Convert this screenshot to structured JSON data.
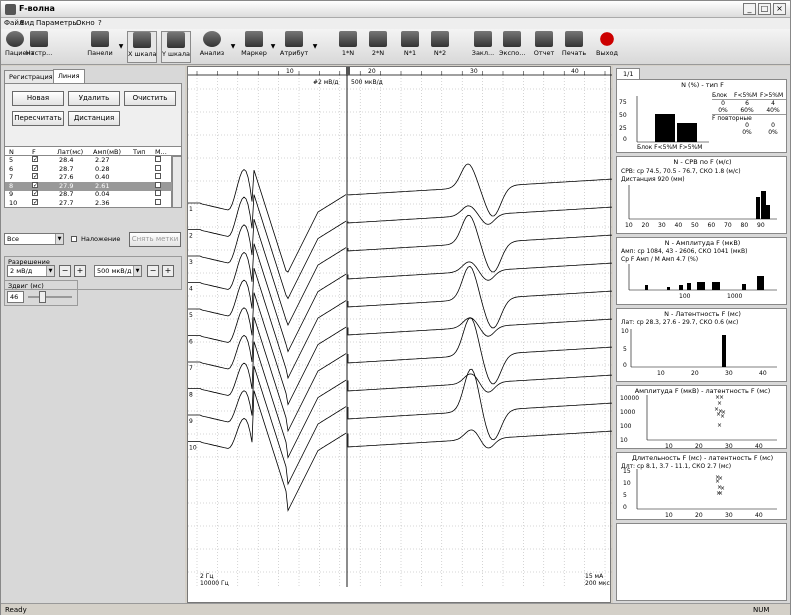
{
  "window": {
    "title": "F-волна",
    "status_left": "Ready",
    "status_right": "NUM"
  },
  "menu": [
    "Файл",
    "Вид",
    "Параметры",
    "Окно",
    "?"
  ],
  "toolbar": [
    {
      "label": "Пациент",
      "icon": "patient-icon"
    },
    {
      "label": "Настр...",
      "icon": "settings-icon"
    },
    {
      "label": "Панели",
      "icon": "panels-icon"
    },
    {
      "label": "X шкала",
      "icon": "x-scale-icon"
    },
    {
      "label": "Y шкала",
      "icon": "y-scale-icon"
    },
    {
      "label": "Анализ",
      "icon": "analysis-icon"
    },
    {
      "label": "Маркер",
      "icon": "marker-icon"
    },
    {
      "label": "Атрибут",
      "icon": "attribute-icon"
    },
    {
      "label": "1*N",
      "icon": "marker-1n-icon"
    },
    {
      "label": "2*N",
      "icon": "marker-2n-icon"
    },
    {
      "label": "N*1",
      "icon": "marker-n1-icon"
    },
    {
      "label": "N*2",
      "icon": "marker-n2-icon"
    },
    {
      "label": "Закл...",
      "icon": "conclusion-icon"
    },
    {
      "label": "Экспо...",
      "icon": "export-icon"
    },
    {
      "label": "Отчет",
      "icon": "report-icon"
    },
    {
      "label": "Печать",
      "icon": "print-icon"
    },
    {
      "label": "Выход",
      "icon": "exit-icon"
    }
  ],
  "left": {
    "tabs": [
      "Регистрация",
      "Линия"
    ],
    "buttons": {
      "new": "Новая",
      "delete": "Удалить",
      "clear": "Очистить",
      "recalc": "Пересчитать",
      "distance": "Дистанция"
    },
    "columns": [
      "N",
      "F",
      "Лат(мс)",
      "Амп(мВ)",
      "Тип",
      "М..."
    ],
    "rows": [
      {
        "n": "5",
        "f": true,
        "lat": "28.4",
        "amp": "2.27",
        "sel": false
      },
      {
        "n": "6",
        "f": true,
        "lat": "28.7",
        "amp": "0.28",
        "sel": false
      },
      {
        "n": "7",
        "f": true,
        "lat": "27.6",
        "amp": "0.40",
        "sel": false
      },
      {
        "n": "8",
        "f": true,
        "lat": "27.9",
        "amp": "2.61",
        "sel": true
      },
      {
        "n": "9",
        "f": true,
        "lat": "28.7",
        "amp": "0.04",
        "sel": false
      },
      {
        "n": "10",
        "f": true,
        "lat": "27.7",
        "amp": "2.36",
        "sel": false
      }
    ],
    "filter": "Все",
    "overlay_label": "Наложение",
    "remove_marks": "Снять метки",
    "resolution_title": "Разрешение",
    "time_res": "2 мВ/д",
    "amp_res": "500 мкВ/д",
    "delay_title": "Здвиг (мс)",
    "delay_value": "46"
  },
  "graph": {
    "scale_left": "#2 мВ/д",
    "scale_right": "500 мкВ/д",
    "time_ticks": [
      "10",
      "20",
      "30",
      "40"
    ],
    "bottom_left": [
      "2 Гц",
      "10000 Гц"
    ],
    "bottom_right": [
      "15 мА",
      "200 мкс"
    ],
    "trace_labels": [
      "1",
      "2",
      "3",
      "4",
      "5",
      "6",
      "7",
      "8",
      "9",
      "10"
    ]
  },
  "right": {
    "tab": "1/1",
    "p1": {
      "title": "N (%) - тип F",
      "yticks": [
        "75",
        "50",
        "25",
        "0"
      ],
      "bottom": "Блок F<5%M F>5%M",
      "table_header": [
        "Блок",
        "F<5%M",
        "F>5%M"
      ],
      "table_row1": [
        "0",
        "6",
        "4"
      ],
      "table_row2": [
        "0%",
        "60%",
        "40%"
      ],
      "repeat_title": "F повторные",
      "repeat_row1": [
        "0",
        "0"
      ],
      "repeat_row2": [
        "0%",
        "0%"
      ]
    },
    "p2": {
      "title": "N - СРВ по F (м/с)",
      "stat1": "СРВ: ср 74.5, 70.5 - 76.7, СКО 1.8 (м/с)",
      "stat2": "Дистанция 920 (мм)",
      "xticks": [
        "10",
        "20",
        "30",
        "40",
        "50",
        "60",
        "70",
        "80",
        "90"
      ]
    },
    "p3": {
      "title": "N - Амплитуда F (мкВ)",
      "stat1": "Амп: ср 1084, 43 - 2606, СКО 1041 (мкВ)",
      "stat2": "Ср F Амп / М Амп 4.7 (%)",
      "xticks": [
        "100",
        "1000"
      ]
    },
    "p4": {
      "title": "N - Латентность F (мс)",
      "stat1": "Лат: ср 28.3, 27.6 - 29.7, СКО 0.6 (мс)",
      "yticks": [
        "10",
        "5",
        "0"
      ],
      "xticks": [
        "10",
        "20",
        "30",
        "40"
      ]
    },
    "p5": {
      "title": "Амплитуда F (мкВ) - латентность F (мс)",
      "yticks": [
        "10000",
        "1000",
        "100",
        "10"
      ],
      "xticks": [
        "10",
        "20",
        "30",
        "40"
      ]
    },
    "p6": {
      "title": "Длительность F (мс) - латентность F (мс)",
      "stat1": "Длт: ср 8.1, 3.7 - 11.1, СКО 2.7 (мс)",
      "yticks": [
        "15",
        "10",
        "5",
        "0"
      ],
      "xticks": [
        "10",
        "20",
        "30",
        "40"
      ]
    }
  }
}
